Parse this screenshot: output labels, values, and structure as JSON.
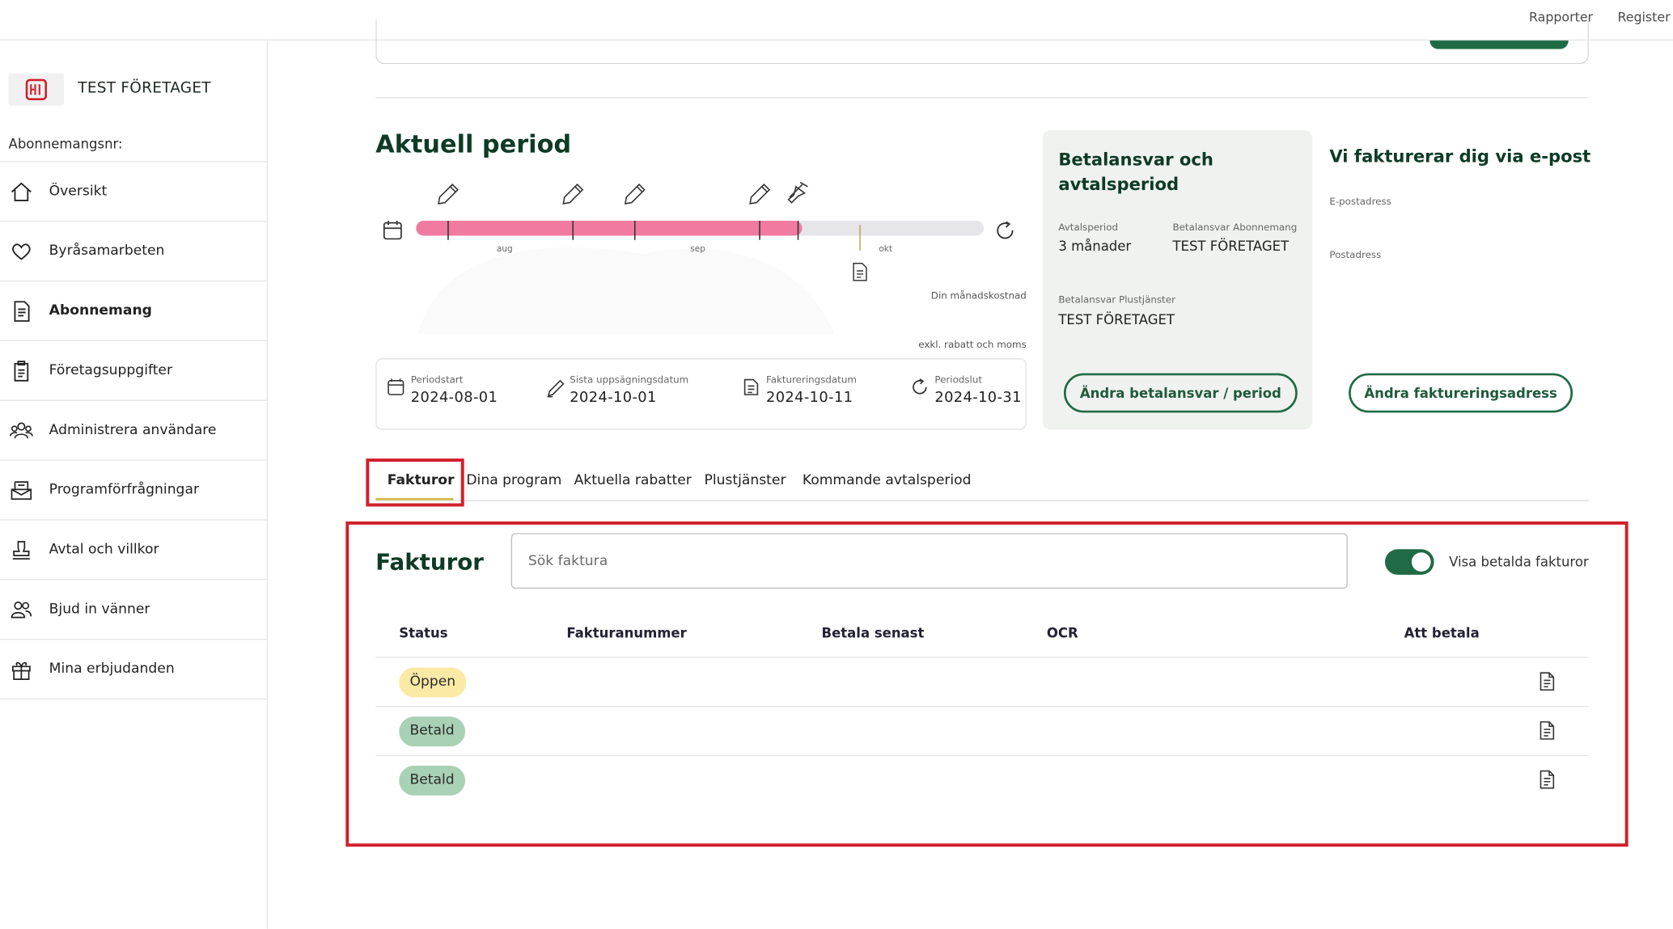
{
  "topbar": {
    "links": [
      "Rapporter",
      "Register"
    ]
  },
  "sidebar": {
    "company": "TEST FÖRETAGET",
    "subscription_label": "Abonnemangsnr:",
    "items": [
      {
        "label": "Översikt",
        "icon": "home-icon"
      },
      {
        "label": "Byråsamarbeten",
        "icon": "heart-icon"
      },
      {
        "label": "Abonnemang",
        "icon": "document-icon"
      },
      {
        "label": "Företagsuppgifter",
        "icon": "clipboard-icon"
      },
      {
        "label": "Administrera användare",
        "icon": "users-icon"
      },
      {
        "label": "Programförfrågningar",
        "icon": "mail-request-icon"
      },
      {
        "label": "Avtal och villkor",
        "icon": "stamp-icon"
      },
      {
        "label": "Bjud in vänner",
        "icon": "invite-friends-icon"
      },
      {
        "label": "Mina erbjudanden",
        "icon": "gift-icon"
      }
    ],
    "active_index": 2
  },
  "period": {
    "title": "Aktuell period",
    "months": [
      "aug",
      "sep",
      "okt"
    ],
    "progress": 0.68,
    "monthly_cost_label": "Din månadskostnad",
    "exkl_label": "exkl. rabatt och moms",
    "dates": [
      {
        "label": "Periodstart",
        "value": "2024-08-01",
        "icon": "calendar-icon"
      },
      {
        "label": "Sista uppsägningsdatum",
        "value": "2024-10-01",
        "icon": "pen-icon"
      },
      {
        "label": "Faktureringsdatum",
        "value": "2024-10-11",
        "icon": "invoice-icon"
      },
      {
        "label": "Periodslut",
        "value": "2024-10-31",
        "icon": "refresh-icon"
      }
    ]
  },
  "payment": {
    "title": "Betalansvar och avtalsperiod",
    "avtalsperiod_label": "Avtalsperiod",
    "avtalsperiod_value": "3 månader",
    "betalansvar_abonnemang_label": "Betalansvar Abonnemang",
    "betalansvar_abonnemang_value": "TEST FÖRETAGET",
    "betalansvar_plus_label": "Betalansvar Plustjänster",
    "betalansvar_plus_value": "TEST FÖRETAGET",
    "button": "Ändra betalansvar / period"
  },
  "invoicing": {
    "title": "Vi fakturerar dig via e-post",
    "email_label": "E-postadress",
    "postal_label": "Postadress",
    "button": "Ändra faktureringsadress"
  },
  "tabs": [
    "Fakturor",
    "Dina program",
    "Aktuella rabatter",
    "Plustjänster",
    "Kommande avtalsperiod"
  ],
  "invoices": {
    "title": "Fakturor",
    "search_placeholder": "Sök faktura",
    "toggle_label": "Visa betalda fakturor",
    "columns": [
      "Status",
      "Fakturanummer",
      "Betala senast",
      "OCR",
      "Att betala"
    ],
    "rows": [
      {
        "status": "Öppen",
        "color": "#fbe9a6"
      },
      {
        "status": "Betald",
        "color": "#a9d1b5"
      },
      {
        "status": "Betald",
        "color": "#a9d1b5"
      }
    ]
  },
  "colors": {
    "brand": "#1f6b45",
    "progress": "#f07aa0",
    "highlight": "#d0202c"
  }
}
